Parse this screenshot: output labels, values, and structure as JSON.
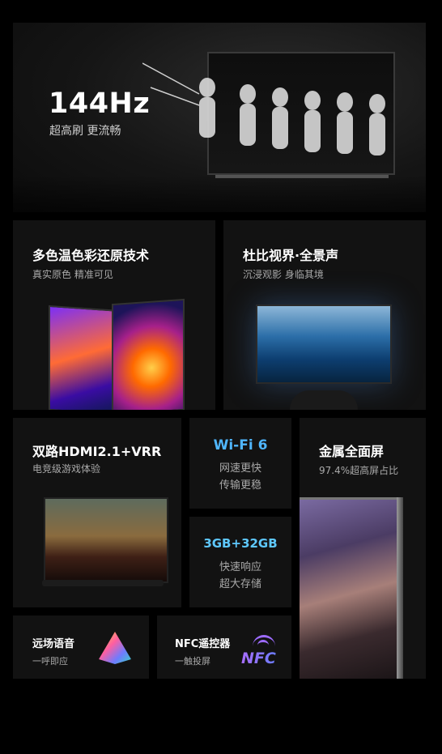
{
  "hero": {
    "headline": "144Hz",
    "tagline": "超高刷 更流畅"
  },
  "features": {
    "color": {
      "title": "多色温色彩还原技术",
      "subtitle": "真实原色 精准可见"
    },
    "dolby": {
      "title": "杜比视界·全景声",
      "subtitle": "沉浸观影 身临其境"
    },
    "hdmi": {
      "title": "双路HDMI2.1+VRR",
      "subtitle": "电竞级游戏体验"
    },
    "wifi": {
      "title": "Wi-Fi 6",
      "line1": "网速更快",
      "line2": "传输更稳"
    },
    "storage": {
      "title": "3GB+32GB",
      "line1": "快速响应",
      "line2": "超大存储"
    },
    "metal": {
      "title": "金属全面屏",
      "subtitle": "97.4%超高屏占比"
    },
    "voice": {
      "title": "远场语音",
      "subtitle": "一呼即应"
    },
    "nfc": {
      "title": "NFC遥控器",
      "subtitle": "一触投屏",
      "logo_text": "NFC"
    }
  },
  "colors": {
    "wifi_accent": "#4fb6ff",
    "storage_accent": "#5ec8ff",
    "nfc_accent": "#9d6bff"
  }
}
